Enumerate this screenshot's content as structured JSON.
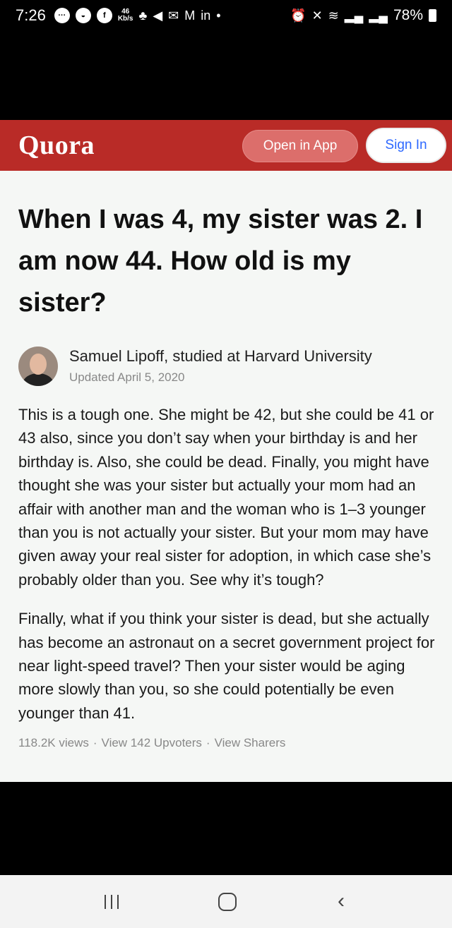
{
  "status_bar": {
    "time": "7:26",
    "kbs_value": "46",
    "kbs_unit": "Kb/s",
    "battery": "78%",
    "icons": [
      "messenger-icon",
      "messenger-lite-icon",
      "facebook-icon",
      "data-speed-icon",
      "tip-icon",
      "send-icon",
      "mail-icon",
      "gmail-icon",
      "linkedin-icon",
      "dot-icon",
      "alarm-icon",
      "mute-icon",
      "wifi-icon",
      "signal-icon",
      "signal-icon-2",
      "battery-icon"
    ]
  },
  "header": {
    "logo": "Quora",
    "open_in_app": "Open in App",
    "sign_in": "Sign In",
    "bg_color": "#b92b27"
  },
  "question": {
    "title": "When I was 4, my sister was 2. I am now 44. How old is my sister?"
  },
  "answer": {
    "author": "Samuel Lipoff, studied at Harvard University",
    "updated": "Updated April 5, 2020",
    "paragraph1": "This is a tough one. She might be 42, but she could be 41 or 43 also, since you don’t say when your birthday is and her birthday is. Also, she could be dead. Finally, you might have thought she was your sister but actually your mom had an affair with another man and the woman who is 1–3 younger than you is not actually your sister. But your mom may have given away your real sister for adoption, in which case she’s probably older than you. See why it’s tough?",
    "paragraph2": "Finally, what if you think your sister is dead, but she actually has become an astronaut on a secret government project for near light-speed travel? Then your sister would be aging more slowly than you, so she could potentially be even younger than 41.",
    "views": "118.2K views",
    "sep1": "·",
    "upvoters": "View 142 Upvoters",
    "sep2": "·",
    "sharers": "View Sharers"
  },
  "navbar": {
    "icons": [
      "recent-apps-icon",
      "home-icon",
      "back-icon"
    ]
  }
}
